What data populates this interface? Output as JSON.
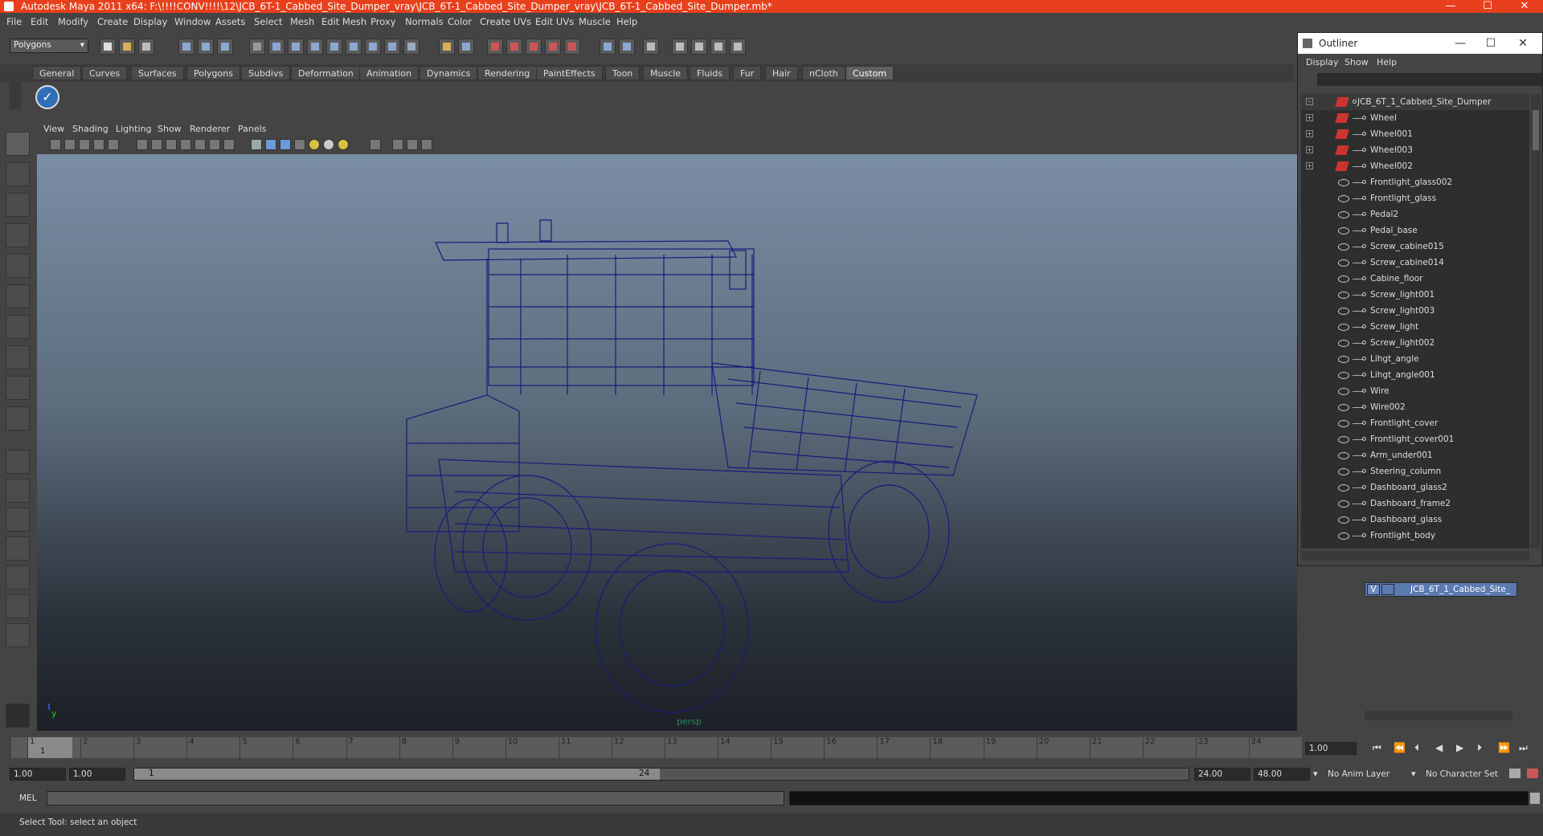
{
  "window": {
    "title": "Autodesk Maya 2011 x64: F:\\!!!!CONV!!!!\\12\\JCB_6T-1_Cabbed_Site_Dumper_vray\\JCB_6T-1_Cabbed_Site_Dumper_vray\\JCB_6T-1_Cabbed_Site_Dumper.mb*",
    "minimize": "—",
    "maximize": "☐",
    "close": "✕"
  },
  "menubar": [
    "File",
    "Edit",
    "Modify",
    "Create",
    "Display",
    "Window",
    "Assets",
    "Select",
    "Mesh",
    "Edit Mesh",
    "Proxy",
    "Normals",
    "Color",
    "Create UVs",
    "Edit UVs",
    "Muscle",
    "Help"
  ],
  "statusline": {
    "mode": "Polygons"
  },
  "shelf_tabs": [
    "General",
    "Curves",
    "Surfaces",
    "Polygons",
    "Subdivs",
    "Deformation",
    "Animation",
    "Dynamics",
    "Rendering",
    "PaintEffects",
    "Toon",
    "Muscle",
    "Fluids",
    "Fur",
    "Hair",
    "nCloth",
    "Custom"
  ],
  "shelf_active_tab": "Custom",
  "viewport": {
    "menu": [
      "View",
      "Shading",
      "Lighting",
      "Show",
      "Renderer",
      "Panels"
    ],
    "camera": "persp",
    "axis_label": "y",
    "wire_color": "#1a1a7a"
  },
  "outliner": {
    "title": "Outliner",
    "menu": [
      "Display",
      "Show",
      "Help"
    ],
    "items": [
      {
        "label": "JCB_6T_1_Cabbed_Site_Dumper",
        "type": "transform",
        "expander": "–",
        "root": true
      },
      {
        "label": "Wheel",
        "type": "transform",
        "expander": "+"
      },
      {
        "label": "Wheel001",
        "type": "transform",
        "expander": "+"
      },
      {
        "label": "Wheel003",
        "type": "transform",
        "expander": "+"
      },
      {
        "label": "Wheel002",
        "type": "transform",
        "expander": "+"
      },
      {
        "label": "Frontlight_glass002",
        "type": "mesh"
      },
      {
        "label": "Frontlight_glass",
        "type": "mesh"
      },
      {
        "label": "Pedal2",
        "type": "mesh"
      },
      {
        "label": "Pedal_base",
        "type": "mesh"
      },
      {
        "label": "Screw_cabine015",
        "type": "mesh"
      },
      {
        "label": "Screw_cabine014",
        "type": "mesh"
      },
      {
        "label": "Cabine_floor",
        "type": "mesh"
      },
      {
        "label": "Screw_light001",
        "type": "mesh"
      },
      {
        "label": "Screw_light003",
        "type": "mesh"
      },
      {
        "label": "Screw_light",
        "type": "mesh"
      },
      {
        "label": "Screw_light002",
        "type": "mesh"
      },
      {
        "label": "Lihgt_angle",
        "type": "mesh"
      },
      {
        "label": "Lihgt_angle001",
        "type": "mesh"
      },
      {
        "label": "Wire",
        "type": "mesh"
      },
      {
        "label": "Wire002",
        "type": "mesh"
      },
      {
        "label": "Frontlight_cover",
        "type": "mesh"
      },
      {
        "label": "Frontlight_cover001",
        "type": "mesh"
      },
      {
        "label": "Arm_under001",
        "type": "mesh"
      },
      {
        "label": "Steering_column",
        "type": "mesh"
      },
      {
        "label": "Dashboard_glass2",
        "type": "mesh"
      },
      {
        "label": "Dashboard_frame2",
        "type": "mesh"
      },
      {
        "label": "Dashboard_glass",
        "type": "mesh"
      },
      {
        "label": "Frontlight_body",
        "type": "mesh"
      }
    ]
  },
  "layer_editor": {
    "layer_visibility": "V",
    "layer_name": "JCB_6T_1_Cabbed_Site_"
  },
  "timeslider": {
    "ticks": [
      "1",
      "2",
      "3",
      "4",
      "5",
      "6",
      "7",
      "8",
      "9",
      "10",
      "11",
      "12",
      "13",
      "14",
      "15",
      "16",
      "17",
      "18",
      "19",
      "20",
      "21",
      "22",
      "23",
      "24"
    ],
    "current_frame_marker": "1",
    "current_time": "1.00"
  },
  "range": {
    "start_time": "1.00",
    "playback_start": "1.00",
    "range_start_label": "1",
    "range_end_label": "24",
    "playback_end": "24.00",
    "end_time": "48.00",
    "anim_layer": "No Anim Layer",
    "character_set": "No Character Set"
  },
  "cmdline": {
    "label": "MEL"
  },
  "helpline": {
    "text": "Select Tool: select an object"
  }
}
